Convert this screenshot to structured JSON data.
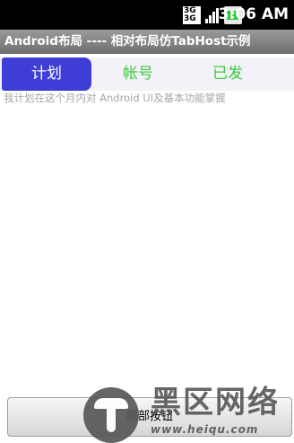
{
  "status_bar": {
    "network_label_top": "3G",
    "network_label_bottom": "3G",
    "signal_icon": "signal-bars-icon",
    "battery_icon": "battery-charging-icon",
    "time": "3:06 AM"
  },
  "title_bar": {
    "title": "Android布局 ---- 相对布局仿TabHost示例"
  },
  "tabs": [
    {
      "label": "计划",
      "selected": true
    },
    {
      "label": "帐号",
      "selected": false
    },
    {
      "label": "已发",
      "selected": false
    }
  ],
  "content": {
    "description": "我计划在这个月内对 Android UI及基本功能掌握"
  },
  "bottom": {
    "button_label": "底部按钮"
  },
  "watermark": {
    "icon": "heiqu-logo-icon",
    "text": "黑区网络",
    "url": "www.heiqu.com"
  },
  "colors": {
    "tab_active_bg": "#3e3ed6",
    "tab_inactive_text": "#3ec93e",
    "description_text": "#a6a6a6"
  }
}
